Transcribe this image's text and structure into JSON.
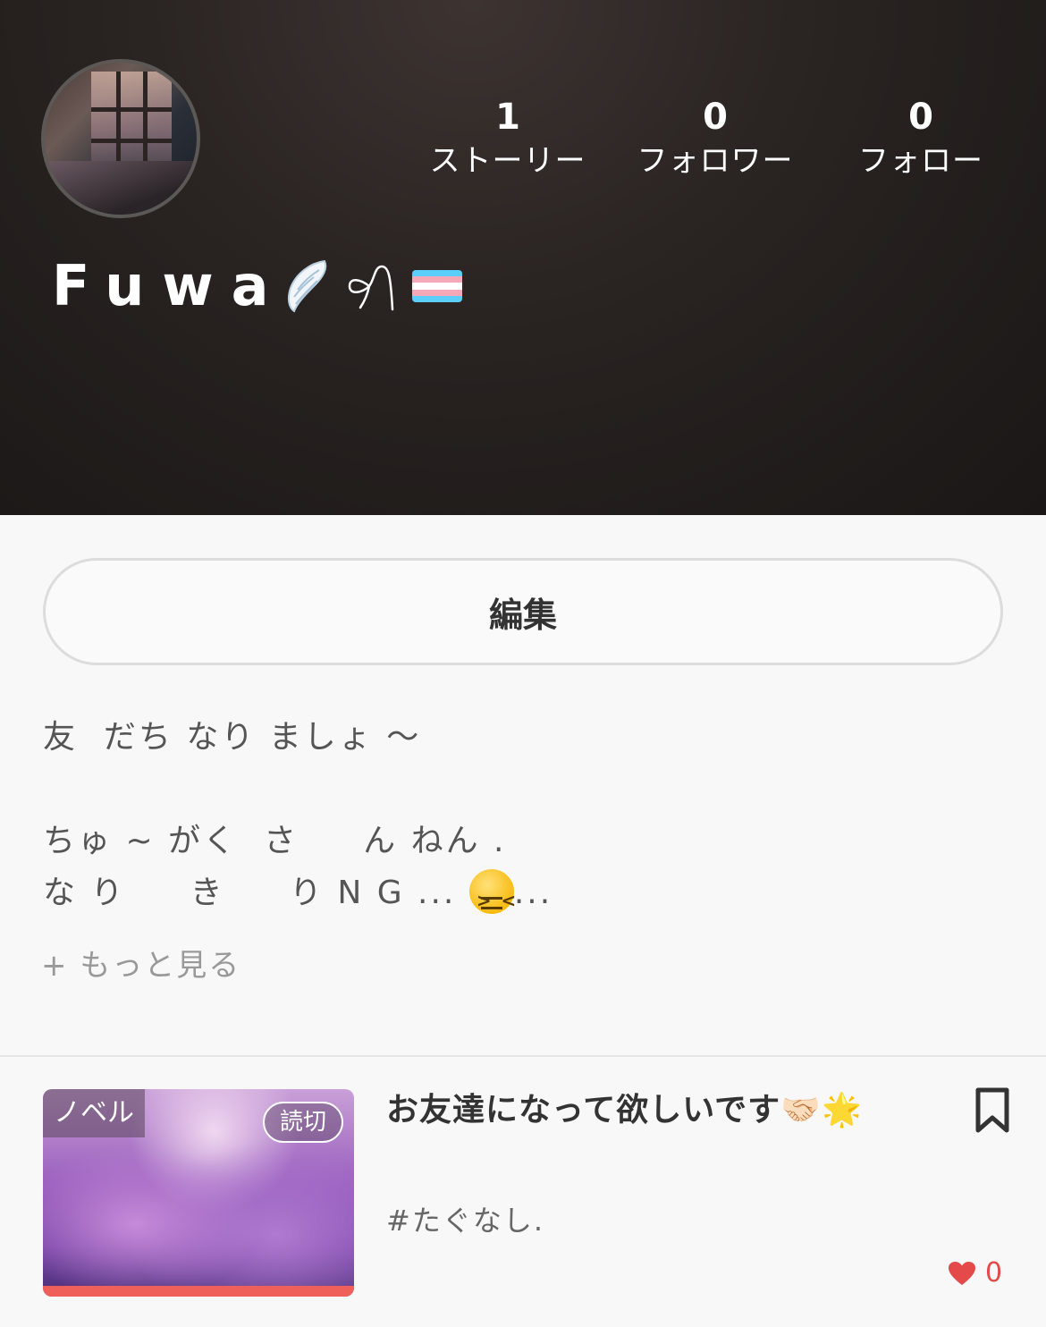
{
  "profile": {
    "name": "Fuwa",
    "stats": [
      {
        "value": "1",
        "label": "ストーリー"
      },
      {
        "value": "0",
        "label": "フォロワー"
      },
      {
        "value": "0",
        "label": "フォロー"
      }
    ],
    "edit_label": "編集",
    "bio_lines": [
      "友  だち なり ましょ ～",
      "",
      "ちゅ ~ がく  さ     ん ねん .",
      "な り     き     り N G ... "
    ],
    "bio_tail": "...",
    "more_label": "+ もっと見る"
  },
  "story": {
    "genre": "ノベル",
    "badge": "読切",
    "title": "お友達になって欲しいです🤝🏻🌟",
    "tag": "#たぐなし.",
    "likes": "0"
  },
  "colors": {
    "accent": "#f0605a",
    "heart": "#e44a4a",
    "header_bg": "#2a2422",
    "trans_blue": "#5bcefa",
    "trans_pink": "#f5a9b8",
    "trans_white": "#ffffff"
  }
}
